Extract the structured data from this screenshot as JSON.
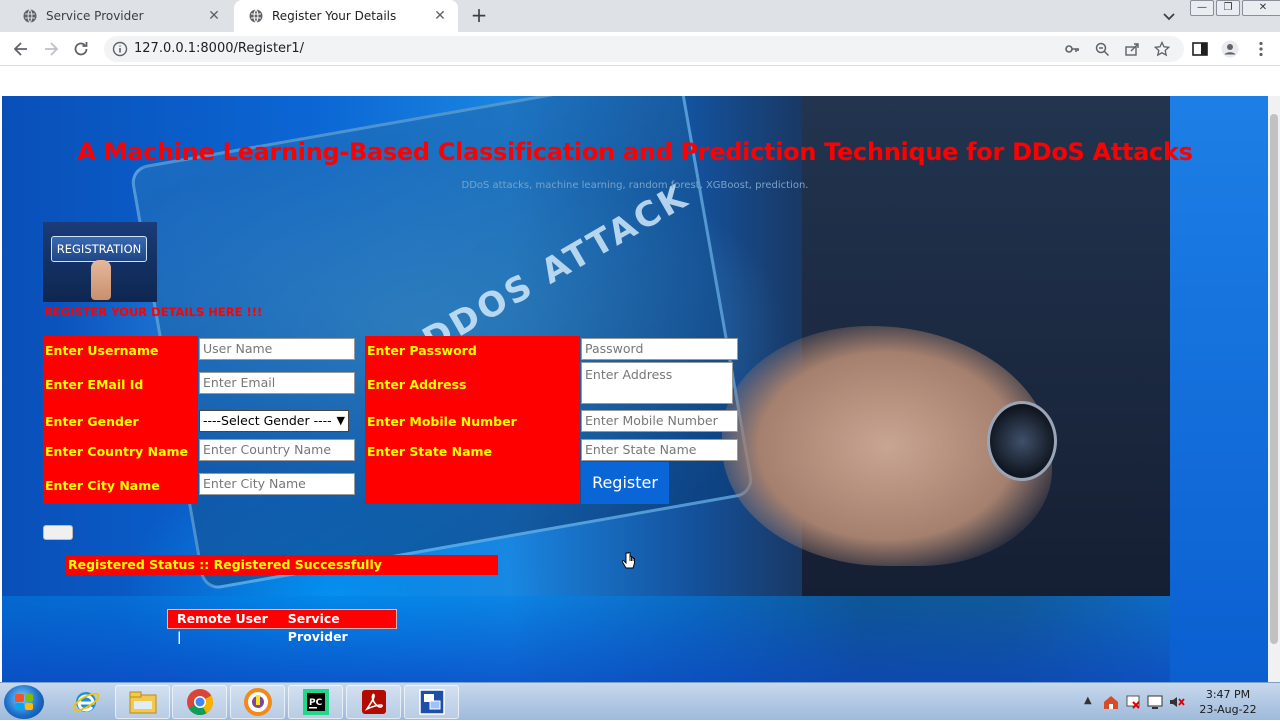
{
  "browser": {
    "tabs": [
      {
        "title": "Service Provider",
        "active": false
      },
      {
        "title": "Register Your Details",
        "active": true
      }
    ],
    "url": "127.0.0.1:8000/Register1/"
  },
  "page": {
    "title": "A Machine Learning-Based Classification and Prediction Technique for DDoS Attacks",
    "subtitle": "DDoS attacks, machine learning, random forest, XGBoost, prediction.",
    "reg_badge": "REGISTRATION",
    "background_text": "DDOS ATTACK",
    "register_note": "REGISTER YOUR DETAILS HERE !!!",
    "form": {
      "username_label": "Enter Username",
      "username_placeholder": "User Name",
      "email_label": "Enter EMail Id",
      "email_placeholder": "Enter Email",
      "gender_label": "Enter Gender",
      "gender_selected": "----Select Gender ----",
      "country_label": "Enter Country Name",
      "country_placeholder": "Enter Country Name",
      "city_label": "Enter City Name",
      "city_placeholder": "Enter City Name",
      "password_label": "Enter Password",
      "password_placeholder": "Password",
      "address_label": "Enter Address",
      "address_placeholder": "Enter Address",
      "mobile_label": "Enter Mobile Number",
      "mobile_placeholder": "Enter Mobile Number",
      "state_label": "Enter State Name",
      "state_placeholder": "Enter State Name",
      "register_label": "Register"
    },
    "status_text": "Registered Status :: Registered Successfully",
    "links": {
      "remote_user": "Remote User |",
      "service_provider": "Service Provider"
    }
  },
  "taskbar": {
    "time": "3:47 PM",
    "date": "23-Aug-22"
  },
  "colors": {
    "accent_red": "#ff0000",
    "label_yellow": "#ffff00",
    "button_blue": "#0a66d6"
  }
}
